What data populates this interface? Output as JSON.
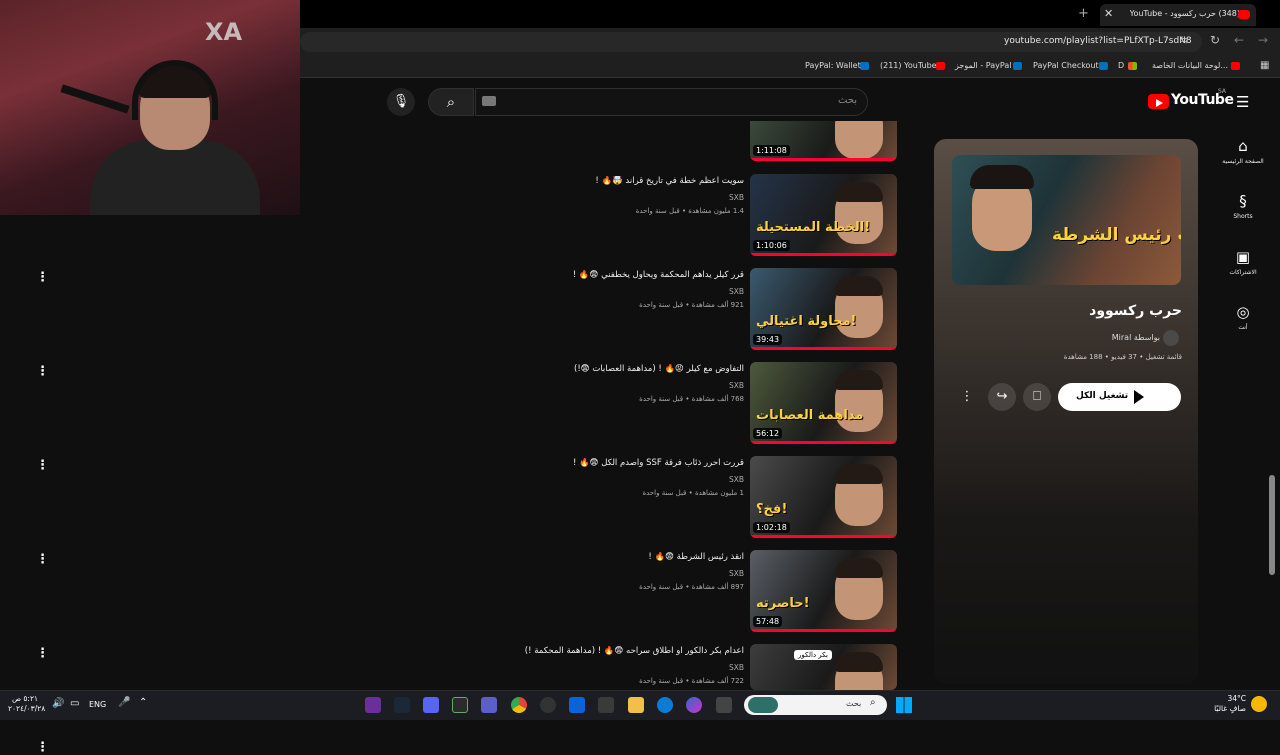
{
  "browser": {
    "tab_title": "(348) حرب ركسوود - YouTube",
    "url": "youtube.com/playlist?list=PLfXTp-L7sdN8",
    "bookmarks": [
      "لوحة البيانات الخاصة...",
      "D",
      "PayPal Checkout",
      "الموجز - PayPal",
      "(211) YouTube",
      "PayPal: Wallet"
    ]
  },
  "masthead": {
    "logo_text": "YouTube",
    "region": "SA",
    "search_placeholder": "بحث"
  },
  "sidebar": [
    {
      "label": "الصفحة الرئيسية",
      "icon": "home-icon"
    },
    {
      "label": "Shorts",
      "icon": "shorts-icon"
    },
    {
      "label": "الاشتراكات",
      "icon": "subscriptions-icon"
    },
    {
      "label": "أنت",
      "icon": "you-icon"
    }
  ],
  "playlist": {
    "title": "حرب ركسوود",
    "owner": "Miral بواسطة",
    "meta": "قائمة تشغيل • 37 فيديو • 188 مشاهدة",
    "play_all": "تشغيل الكل",
    "thumb_text": "نائب رئيس الشرطة"
  },
  "videos": [
    {
      "title": "",
      "channel": "",
      "meta": "",
      "duration": "1:11:08",
      "thumb_text": "",
      "thumb_color": "#3b4a3a"
    },
    {
      "title": "سويت اعظم خطة في تاريخ قراند 🤯🔥 !",
      "channel": "SXB",
      "meta": "1.4 مليون مشاهدة • قبل سنة واحدة",
      "duration": "1:10:06",
      "thumb_text": "الخطة المستحيلة!",
      "thumb_color": "#24344a"
    },
    {
      "title": "قرر كيلر يداهم المحكمة ويحاول يخطفني 😨🔥 !",
      "channel": "SXB",
      "meta": "921 ألف مشاهدة • قبل سنة واحدة",
      "duration": "39:43",
      "thumb_text": "محاولة اغتيالي!",
      "thumb_color": "#3a5a70"
    },
    {
      "title": "التفاوض مع كيلر 😡🔥 ! (مداهمة العصابات 😨!)",
      "channel": "SXB",
      "meta": "768 ألف مشاهدة • قبل سنة واحدة",
      "duration": "56:12",
      "thumb_text": "مداهمة العصابات",
      "thumb_color": "#4d5a3c"
    },
    {
      "title": "قررت احرر ذئاب فرقة SSF واصدم الكل 😨🔥 !",
      "channel": "SXB",
      "meta": "1 مليون مشاهدة • قبل سنة واحدة",
      "duration": "1:02:18",
      "thumb_text": "فخ؟!",
      "thumb_color": "#4b4b4b"
    },
    {
      "title": "انقذ رئيس الشرطة 😨🔥 !",
      "channel": "SXB",
      "meta": "897 ألف مشاهدة • قبل سنة واحدة",
      "duration": "57:48",
      "thumb_text": "حاصرته!",
      "thumb_color": "#5a5f66"
    },
    {
      "title": "اعدام بكر دالكور او اطلاق سراحه 😨🔥 ! (مداهمة المحكمة !)",
      "channel": "SXB",
      "meta": "722 ألف مشاهدة • قبل سنة واحدة",
      "duration": "",
      "thumb_text": "بكر دالكور",
      "thumb_color": "#3d3d3d"
    }
  ],
  "taskbar": {
    "search_placeholder": "بحث",
    "lang": "ENG",
    "time": "٥:٢١ ص",
    "date": "٢٠٢٤/٠٣/٢٨",
    "temp": "34°C",
    "weather": "صافٍ غالبًا"
  },
  "colors": {
    "accent": "#ff0000",
    "progress": "#ff0033"
  }
}
